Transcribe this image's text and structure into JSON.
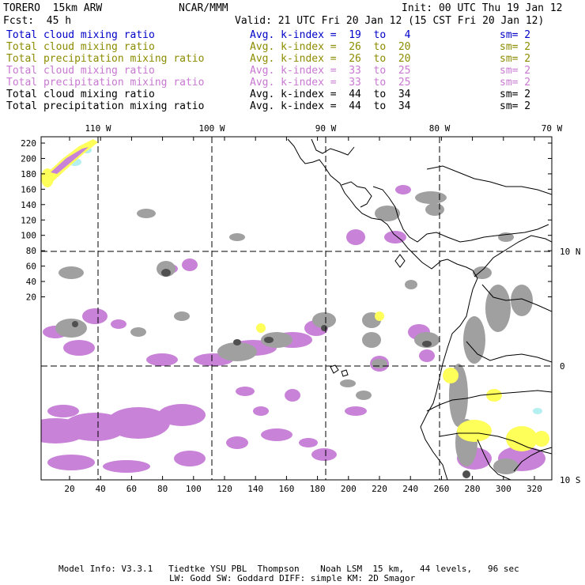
{
  "header": {
    "model": "TORERO  15km ARW",
    "org": "NCAR/MMM",
    "init": "Init: 00 UTC Thu 19 Jan 12",
    "fcst": "Fcst:  45 h",
    "valid": "Valid: 21 UTC Fri 20 Jan 12 (15 CST Fri 20 Jan 12)"
  },
  "legend": [
    {
      "label": "Total cloud mixing ratio",
      "kindex": "Avg. k-index =  19  to   4",
      "sm": "sm= 2",
      "color": "#0000c8"
    },
    {
      "label": "Total cloud mixing ratio",
      "kindex": "Avg. k-index =  26  to  20",
      "sm": "sm= 2",
      "color": "#8c8c00"
    },
    {
      "label": "Total precipitation mixing ratio",
      "kindex": "Avg. k-index =  26  to  20",
      "sm": "sm= 2",
      "color": "#8c8c00"
    },
    {
      "label": "Total cloud mixing ratio",
      "kindex": "Avg. k-index =  33  to  25",
      "sm": "sm= 2",
      "color": "#c878d2"
    },
    {
      "label": "Total precipitation mixing ratio",
      "kindex": "Avg. k-index =  33  to  25",
      "sm": "sm= 2",
      "color": "#c878d2"
    },
    {
      "label": "Total cloud mixing ratio",
      "kindex": "Avg. k-index =  44  to  34",
      "sm": "sm= 2",
      "color": "#000000"
    },
    {
      "label": "Total precipitation mixing ratio",
      "kindex": "Avg. k-index =  44  to  34",
      "sm": "sm= 2",
      "color": "#000000"
    }
  ],
  "map": {
    "lon_labels": [
      "110 W",
      "100 W",
      "90 W",
      "80 W",
      "70 W"
    ],
    "lat_labels": [
      "10 N",
      "0",
      "10 S"
    ],
    "y_ticks": [
      "220",
      "200",
      "180",
      "160",
      "140",
      "120",
      "100",
      "80",
      "60",
      "40",
      "20"
    ],
    "x_ticks": [
      "20",
      "40",
      "60",
      "80",
      "100",
      "120",
      "140",
      "160",
      "180",
      "200",
      "220",
      "240",
      "260",
      "280",
      "300",
      "320"
    ],
    "colors": {
      "purple": "#c882d7",
      "gray": "#a0a0a0",
      "yellow": "#ffff5a",
      "cyan": "#b4f0f0",
      "dark": "#505050"
    }
  },
  "footer": {
    "line1": "Model Info: V3.3.1   Tiedtke YSU PBL  Thompson    Noah LSM  15 km,   44 levels,   96 sec",
    "line2": "LW: Godd SW: Goddard DIFF: simple KM: 2D Smagor"
  }
}
